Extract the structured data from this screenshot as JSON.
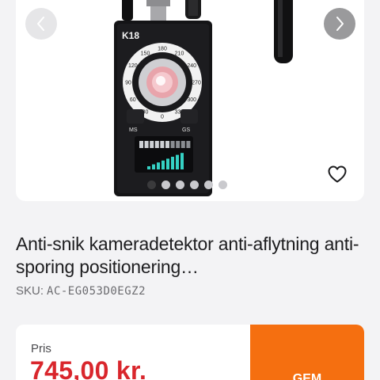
{
  "gallery": {
    "device_model_label": "K18",
    "device_left_button_label": "MS",
    "device_right_button_label": "GS",
    "dial_numbers": [
      "0",
      "30",
      "60",
      "90",
      "120",
      "150",
      "180",
      "210",
      "240",
      "270",
      "300",
      "330"
    ],
    "dot_count": 6,
    "active_dot_index": 0
  },
  "product": {
    "title": "Anti-snik kameradetektor anti-aflytning anti-sporing positionering…",
    "sku_label": "SKU:",
    "sku_value": "AC-EG053D0EGZ2"
  },
  "pricing": {
    "label": "Pris",
    "price": "745,00 kr.",
    "cta_label": "GEM"
  },
  "colors": {
    "price_red": "#d9262c",
    "cta_orange": "#f56f10",
    "background": "#f3f3f5"
  },
  "icons": {
    "prev": "chevron-left-icon",
    "next": "chevron-right-icon",
    "favorite": "heart-outline-icon"
  }
}
